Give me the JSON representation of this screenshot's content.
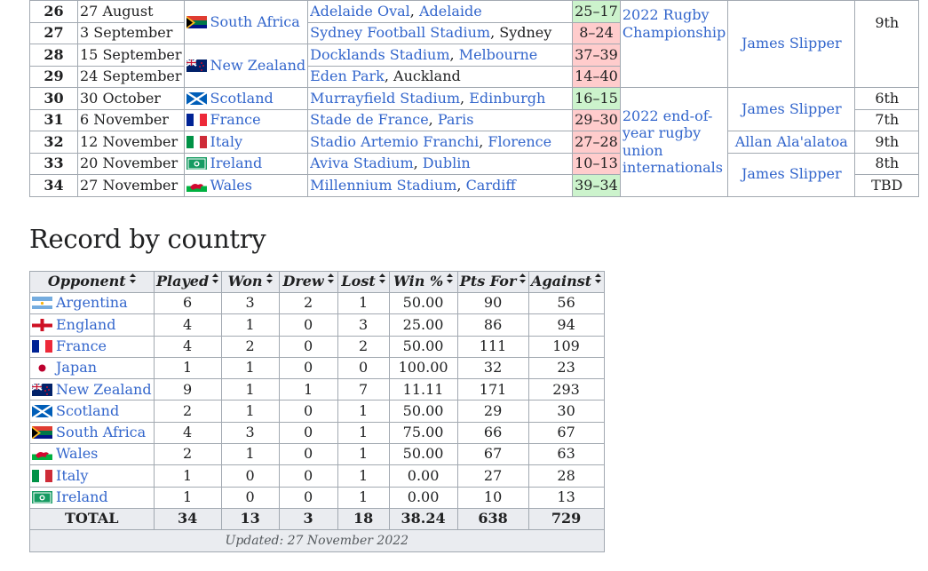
{
  "fixtures": [
    {
      "no": "26",
      "date": "27 August",
      "opponent": "South Africa",
      "flag": "south-africa",
      "venue": "Adelaide Oval",
      "city": "Adelaide",
      "score": "25–17",
      "result": "win"
    },
    {
      "no": "27",
      "date": "3 September",
      "opponent": "",
      "flag": "",
      "venue": "Sydney Football Stadium",
      "city": "Sydney",
      "score": "8–24",
      "result": "loss"
    },
    {
      "no": "28",
      "date": "15 September",
      "opponent": "New Zealand",
      "flag": "new-zealand",
      "venue": "Docklands Stadium",
      "city": "Melbourne",
      "score": "37–39",
      "result": "loss"
    },
    {
      "no": "29",
      "date": "24 September",
      "opponent": "",
      "flag": "",
      "venue": "Eden Park",
      "city": "Auckland",
      "score": "14–40",
      "result": "loss"
    },
    {
      "no": "30",
      "date": "30 October",
      "opponent": "Scotland",
      "flag": "scotland",
      "venue": "Murrayfield Stadium",
      "city": "Edinburgh",
      "score": "16–15",
      "result": "win"
    },
    {
      "no": "31",
      "date": "6 November",
      "opponent": "France",
      "flag": "france",
      "venue": "Stade de France",
      "city": "Paris",
      "score": "29–30",
      "result": "loss"
    },
    {
      "no": "32",
      "date": "12 November",
      "opponent": "Italy",
      "flag": "italy",
      "venue": "Stadio Artemio Franchi",
      "city": "Florence",
      "score": "27–28",
      "result": "loss"
    },
    {
      "no": "33",
      "date": "20 November",
      "opponent": "Ireland",
      "flag": "ireland",
      "venue": "Aviva Stadium",
      "city": "Dublin",
      "score": "10–13",
      "result": "loss"
    },
    {
      "no": "34",
      "date": "27 November",
      "opponent": "Wales",
      "flag": "wales",
      "venue": "Millennium Stadium",
      "city": "Cardiff",
      "score": "39–34",
      "result": "win"
    }
  ],
  "competitions": [
    "2022 Rugby Championship",
    "2022 end-of-year rugby union internationals"
  ],
  "captains": [
    "James Slipper",
    "James Slipper",
    "Allan Ala'alatoa",
    "James Slipper"
  ],
  "positions": [
    "9th",
    "6th",
    "7th",
    "9th",
    "8th",
    "TBD"
  ],
  "record_heading": "Record by country",
  "record_headers": [
    "Opponent",
    "Played",
    "Won",
    "Drew",
    "Lost",
    "Win %",
    "Pts For",
    "Against"
  ],
  "record_rows": [
    {
      "opponent": "Argentina",
      "flag": "argentina",
      "played": "6",
      "won": "3",
      "drew": "2",
      "lost": "1",
      "winpct": "50.00",
      "pf": "90",
      "against": "56"
    },
    {
      "opponent": "England",
      "flag": "england",
      "played": "4",
      "won": "1",
      "drew": "0",
      "lost": "3",
      "winpct": "25.00",
      "pf": "86",
      "against": "94"
    },
    {
      "opponent": "France",
      "flag": "france",
      "played": "4",
      "won": "2",
      "drew": "0",
      "lost": "2",
      "winpct": "50.00",
      "pf": "111",
      "against": "109"
    },
    {
      "opponent": "Japan",
      "flag": "japan",
      "played": "1",
      "won": "1",
      "drew": "0",
      "lost": "0",
      "winpct": "100.00",
      "pf": "32",
      "against": "23"
    },
    {
      "opponent": "New Zealand",
      "flag": "new-zealand",
      "played": "9",
      "won": "1",
      "drew": "1",
      "lost": "7",
      "winpct": "11.11",
      "pf": "171",
      "against": "293"
    },
    {
      "opponent": "Scotland",
      "flag": "scotland",
      "played": "2",
      "won": "1",
      "drew": "0",
      "lost": "1",
      "winpct": "50.00",
      "pf": "29",
      "against": "30"
    },
    {
      "opponent": "South Africa",
      "flag": "south-africa",
      "played": "4",
      "won": "3",
      "drew": "0",
      "lost": "1",
      "winpct": "75.00",
      "pf": "66",
      "against": "67"
    },
    {
      "opponent": "Wales",
      "flag": "wales",
      "played": "2",
      "won": "1",
      "drew": "0",
      "lost": "1",
      "winpct": "50.00",
      "pf": "67",
      "against": "63"
    },
    {
      "opponent": "Italy",
      "flag": "italy",
      "played": "1",
      "won": "0",
      "drew": "0",
      "lost": "1",
      "winpct": "0.00",
      "pf": "27",
      "against": "28"
    },
    {
      "opponent": "Ireland",
      "flag": "ireland",
      "played": "1",
      "won": "0",
      "drew": "0",
      "lost": "1",
      "winpct": "0.00",
      "pf": "10",
      "against": "13"
    }
  ],
  "total": {
    "label": "TOTAL",
    "played": "34",
    "won": "13",
    "drew": "3",
    "lost": "18",
    "winpct": "38.24",
    "pf": "638",
    "against": "729"
  },
  "updated": "Updated: 27 November 2022",
  "colors": {
    "link": "#3366cc",
    "win": "#ccf3cc",
    "loss": "#ffcccc",
    "header": "#eaecf0",
    "border": "#a2a9b1"
  }
}
